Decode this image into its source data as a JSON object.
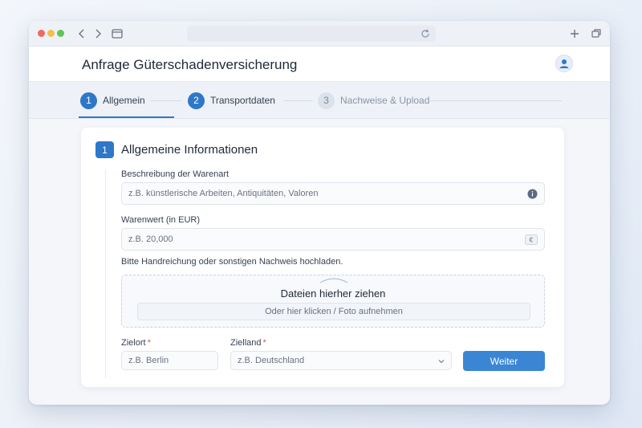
{
  "window": {
    "icons": {
      "back": "chevron-left-icon",
      "forward": "chevron-right-icon",
      "sidebar": "sidebar-icon",
      "reload": "reload-icon",
      "new_tab": "plus-icon",
      "tabs": "tabs-icon"
    }
  },
  "header": {
    "title": "Anfrage Güterschadenversicherung",
    "avatar_icon": "user-icon"
  },
  "steps": [
    {
      "number": "1",
      "label": "Allgemein",
      "state": "active"
    },
    {
      "number": "2",
      "label": "Transportdaten",
      "state": "active"
    },
    {
      "number": "3",
      "label": "Nachweise & Upload",
      "state": "inactive"
    }
  ],
  "section": {
    "number": "1",
    "title": "Allgemeine Informationen"
  },
  "form": {
    "goods_description": {
      "label": "Beschreibung der Warenart",
      "placeholder": "z.B. künstlerische Arbeiten, Antiquitäten, Valoren",
      "icon": "info-icon"
    },
    "goods_value": {
      "label": "Warenwert (in EUR)",
      "placeholder": "z.B. 20,000",
      "icon": "euro-icon"
    },
    "upload": {
      "hint": "Bitte Handreichung oder sonstigen Nachweis hochladen.",
      "title": "Dateien hierher ziehen",
      "button": "Oder hier klicken / Foto aufnehmen"
    },
    "destination": {
      "label": "Zielort",
      "required_mark": "*",
      "placeholder": "z.B. Berlin"
    },
    "country": {
      "label": "Zielland",
      "required_mark": "*",
      "placeholder": "z.B. Deutschland"
    },
    "next_button": "Weiter"
  },
  "colors": {
    "accent": "#2f78c8",
    "button": "#3b86d4",
    "required": "#e05252"
  }
}
